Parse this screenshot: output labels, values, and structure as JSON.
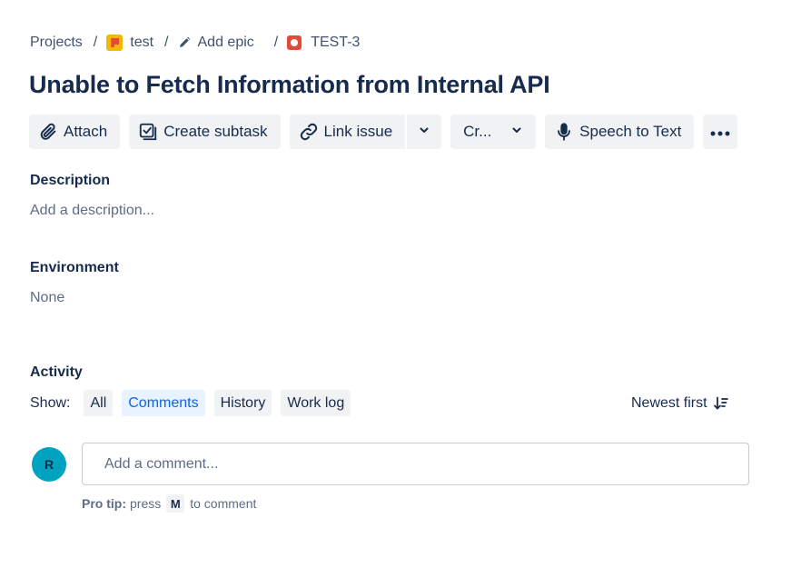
{
  "breadcrumb": {
    "projects": "Projects",
    "project": "test",
    "epic": "Add epic",
    "issue_key": "TEST-3",
    "separator": "/"
  },
  "issue": {
    "title": "Unable to Fetch Information from Internal API"
  },
  "toolbar": {
    "attach": "Attach",
    "create_subtask": "Create subtask",
    "link_issue": "Link issue",
    "create_truncated": "Cr...",
    "speech_to_text": "Speech to Text",
    "more_icon": "more-horizontal-icon"
  },
  "description": {
    "label": "Description",
    "placeholder": "Add a description..."
  },
  "environment": {
    "label": "Environment",
    "value": "None"
  },
  "activity": {
    "label": "Activity",
    "show_label": "Show:",
    "filters": [
      "All",
      "Comments",
      "History",
      "Work log"
    ],
    "active_filter": "Comments",
    "sort_label": "Newest first"
  },
  "comment": {
    "avatar_initial": "R",
    "placeholder": "Add a comment...",
    "pro_tip_label": "Pro tip:",
    "pro_tip_press": "press",
    "pro_tip_key": "M",
    "pro_tip_suffix": "to comment"
  },
  "colors": {
    "text": "#172b4d",
    "subtle": "#5e6c84",
    "button_bg": "#f1f2f4",
    "selected_bg": "#e9f2ff",
    "selected_text": "#0c66e4",
    "avatar_bg": "#00a3bf",
    "issue_icon": "#e5493a",
    "project_icon": "#f5b800"
  }
}
